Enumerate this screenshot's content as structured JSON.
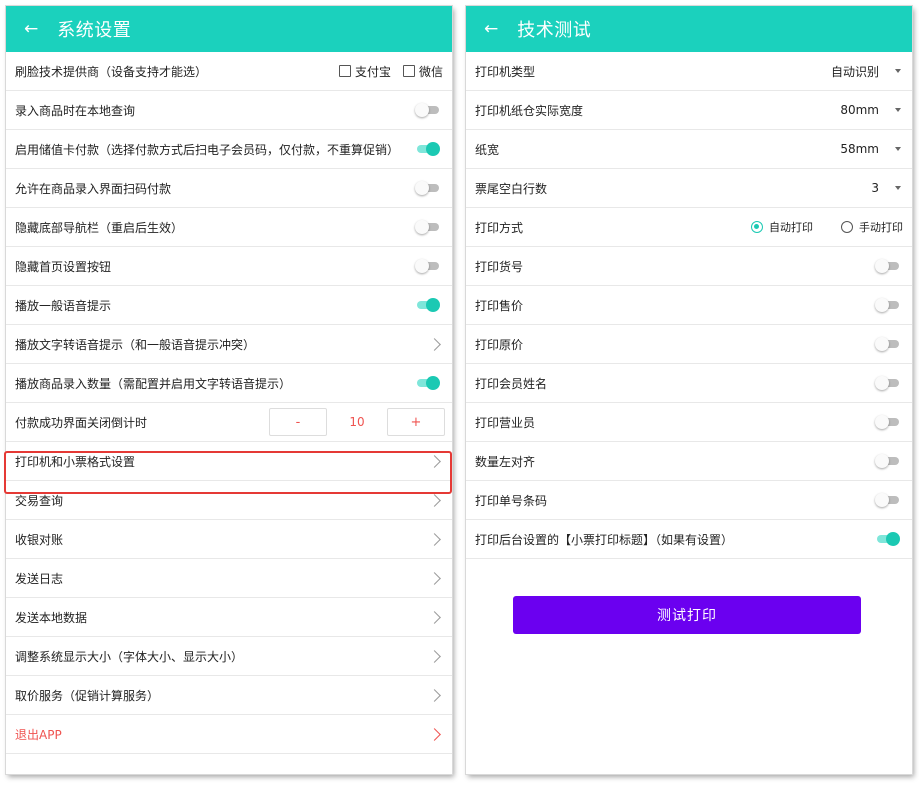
{
  "left": {
    "title": "系统设置",
    "back_icon": "←",
    "face_provider": {
      "label": "刷脸技术提供商（设备支持才能选）",
      "option_alipay": "支付宝",
      "option_wechat": "微信"
    },
    "local_query": {
      "label": "录入商品时在本地查询",
      "on": false
    },
    "stored_card": {
      "label": "启用储值卡付款（选择付款方式后扫电子会员码，仅付款，不重算促销）",
      "on": true
    },
    "scan_pay": {
      "label": "允许在商品录入界面扫码付款",
      "on": false
    },
    "hide_nav": {
      "label": "隐藏底部导航栏（重启后生效）",
      "on": false
    },
    "hide_settings": {
      "label": "隐藏首页设置按钮",
      "on": false
    },
    "voice": {
      "label": "播放一般语音提示",
      "on": true
    },
    "tts": {
      "label": "播放文字转语音提示（和一般语音提示冲突）"
    },
    "qty_voice": {
      "label": "播放商品录入数量（需配置并启用文字转语音提示）",
      "on": true
    },
    "countdown": {
      "label": "付款成功界面关闭倒计时",
      "minus": "-",
      "value": "10",
      "plus": "+"
    },
    "printer_settings": {
      "label": "打印机和小票格式设置"
    },
    "trade_query": {
      "label": "交易查询"
    },
    "reconcile": {
      "label": "收银对账"
    },
    "send_log": {
      "label": "发送日志"
    },
    "send_data": {
      "label": "发送本地数据"
    },
    "display_size": {
      "label": "调整系统显示大小（字体大小、显示大小）"
    },
    "price_service": {
      "label": "取价服务（促销计算服务）"
    },
    "exit": {
      "label": "退出APP"
    }
  },
  "right": {
    "title": "技术测试",
    "back_icon": "←",
    "printer_type": {
      "label": "打印机类型",
      "value": "自动识别"
    },
    "paper_bin": {
      "label": "打印机纸仓实际宽度",
      "value": "80mm"
    },
    "paper_width": {
      "label": "纸宽",
      "value": "58mm"
    },
    "blank_lines": {
      "label": "票尾空白行数",
      "value": "3"
    },
    "print_mode": {
      "label": "打印方式",
      "auto": "自动打印",
      "manual": "手动打印",
      "selected": "auto"
    },
    "print_sku": {
      "label": "打印货号",
      "on": false
    },
    "print_price": {
      "label": "打印售价",
      "on": false
    },
    "print_orig": {
      "label": "打印原价",
      "on": false
    },
    "print_member": {
      "label": "打印会员姓名",
      "on": false
    },
    "print_clerk": {
      "label": "打印营业员",
      "on": false
    },
    "qty_left": {
      "label": "数量左对齐",
      "on": false
    },
    "print_barcode": {
      "label": "打印单号条码",
      "on": false
    },
    "print_title": {
      "label": "打印后台设置的【小票打印标题】（如果有设置）",
      "on": true
    },
    "test_button": "测试打印"
  },
  "colors": {
    "accent": "#1bd1bd",
    "button": "#6b00f0",
    "danger": "#ef5350",
    "highlight": "#e53935"
  }
}
